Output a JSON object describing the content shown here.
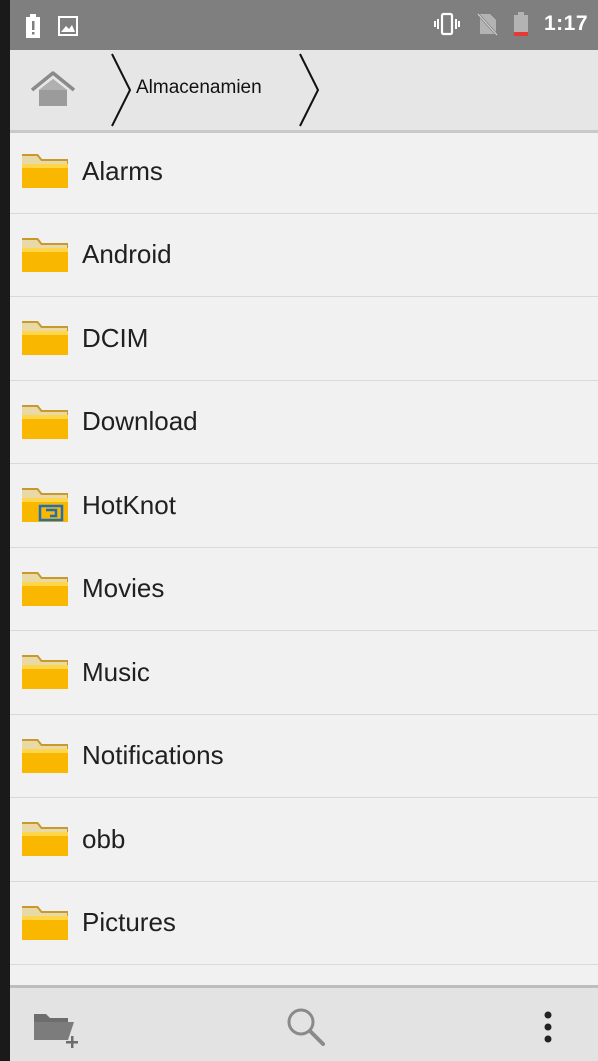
{
  "status_bar": {
    "time": "1:17",
    "left_icons": [
      "battery-alert-icon",
      "image-notification-icon"
    ],
    "right_icons": [
      "vibrate-icon",
      "no-sim-icon",
      "battery-low-icon"
    ]
  },
  "breadcrumb": {
    "home_icon": "home-icon",
    "current": "Almacenamien"
  },
  "files": [
    {
      "name": "Alarms",
      "icon": "folder-icon"
    },
    {
      "name": "Android",
      "icon": "folder-icon"
    },
    {
      "name": "DCIM",
      "icon": "folder-icon"
    },
    {
      "name": "Download",
      "icon": "folder-icon"
    },
    {
      "name": "HotKnot",
      "icon": "hotknot-folder-icon"
    },
    {
      "name": "Movies",
      "icon": "folder-icon"
    },
    {
      "name": "Music",
      "icon": "folder-icon"
    },
    {
      "name": "Notifications",
      "icon": "folder-icon"
    },
    {
      "name": "obb",
      "icon": "folder-icon"
    },
    {
      "name": "Pictures",
      "icon": "folder-icon"
    }
  ],
  "toolbar": {
    "new_folder_icon": "new-folder-icon",
    "search_icon": "search-icon",
    "menu_icon": "more-vert-icon"
  },
  "colors": {
    "status_bar": "#7f7f7f",
    "folder": "#f9b700",
    "background": "#f1f1f1"
  }
}
